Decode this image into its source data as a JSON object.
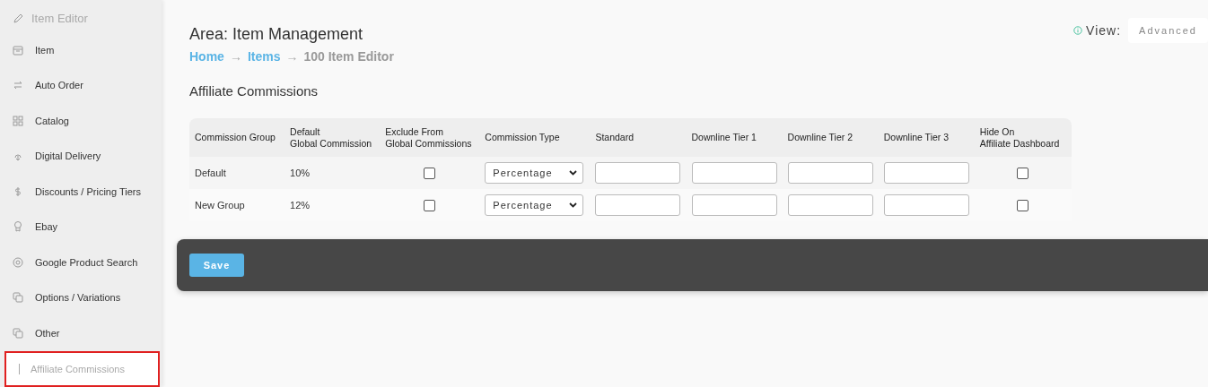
{
  "sidebar": {
    "header": "Item Editor",
    "items": [
      {
        "label": "Item",
        "selected": false
      },
      {
        "label": "Auto Order",
        "selected": false
      },
      {
        "label": "Catalog",
        "selected": false
      },
      {
        "label": "Digital Delivery",
        "selected": false
      },
      {
        "label": "Discounts / Pricing Tiers",
        "selected": false
      },
      {
        "label": "Ebay",
        "selected": false
      },
      {
        "label": "Google Product Search",
        "selected": false
      },
      {
        "label": "Options / Variations",
        "selected": false
      },
      {
        "label": "Other",
        "selected": false
      },
      {
        "label": "Affiliate Commissions",
        "selected": true
      }
    ]
  },
  "header": {
    "title": "Area: Item Management",
    "breadcrumb": [
      {
        "label": "Home",
        "link": true
      },
      {
        "label": "→",
        "link": false
      },
      {
        "label": "Items",
        "link": true
      },
      {
        "label": "→",
        "link": false
      },
      {
        "label": "100 Item Editor",
        "link": false
      }
    ],
    "view_label": "View:",
    "view_value": "Advanced"
  },
  "section_title": "Affiliate Commissions",
  "table": {
    "columns": [
      [
        "Commission Group"
      ],
      [
        "Default",
        "Global Commission"
      ],
      [
        "Exclude From",
        "Global Commissions"
      ],
      [
        "Commission Type"
      ],
      [
        "Standard"
      ],
      [
        "Downline Tier 1"
      ],
      [
        "Downline Tier 2"
      ],
      [
        "Downline Tier 3"
      ],
      [
        "Hide On",
        "Affiliate Dashboard"
      ]
    ],
    "rows": [
      {
        "group": "Default",
        "default_commission": "10%",
        "exclude": false,
        "type": "Percentage",
        "hide": false
      },
      {
        "group": "New Group",
        "default_commission": "12%",
        "exclude": false,
        "type": "Percentage",
        "hide": false
      }
    ]
  },
  "save_button": "Save"
}
